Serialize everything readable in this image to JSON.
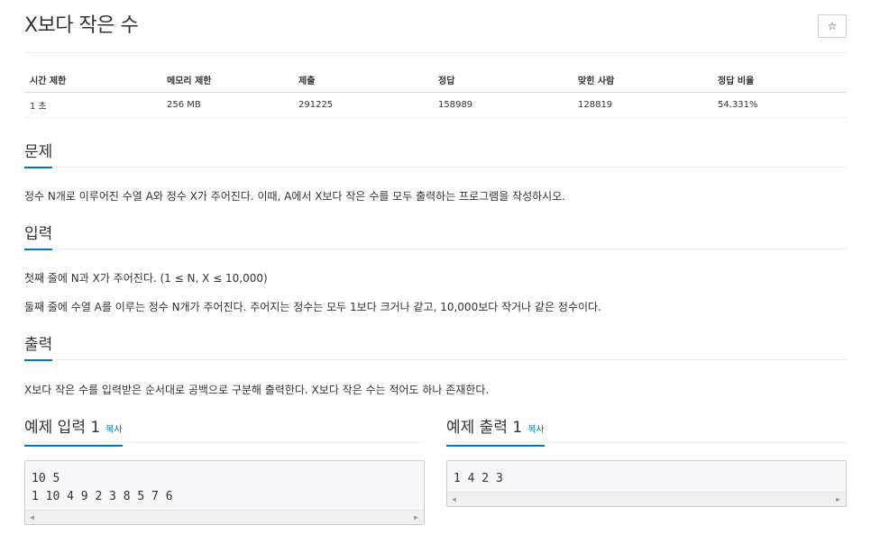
{
  "problem": {
    "title": "X보다 작은 수",
    "star_label": "☆"
  },
  "info_table": {
    "headers": [
      "시간 제한",
      "메모리 제한",
      "제출",
      "정답",
      "맞힌 사람",
      "정답 비율"
    ],
    "values": [
      "1 초",
      "256 MB",
      "291225",
      "158989",
      "128819",
      "54.331%"
    ]
  },
  "sections": {
    "description": {
      "heading": "문제",
      "text": "정수 N개로 이루어진 수열 A와 정수 X가 주어진다. 이때, A에서 X보다 작은 수를 모두 출력하는 프로그램을 작성하시오."
    },
    "input": {
      "heading": "입력",
      "line1": "첫째 줄에 N과 X가 주어진다. (1 ≤ N, X ≤ 10,000)",
      "line2": "둘째 줄에 수열 A를 이루는 정수 N개가 주어진다. 주어지는 정수는 모두 1보다 크거나 같고, 10,000보다 작거나 같은 정수이다."
    },
    "output": {
      "heading": "출력",
      "text": "X보다 작은 수를 입력받은 순서대로 공백으로 구분해 출력한다. X보다 작은 수는 적어도 하나 존재한다."
    }
  },
  "samples": {
    "copy_label": "복사",
    "input": {
      "heading": "예제 입력 1",
      "code": "10 5\n1 10 4 9 2 3 8 5 7 6"
    },
    "output": {
      "heading": "예제 출력 1",
      "code": "1 4 2 3"
    }
  },
  "colors": {
    "accent": "#0076c0",
    "pre_background": "#f7f7f9"
  }
}
